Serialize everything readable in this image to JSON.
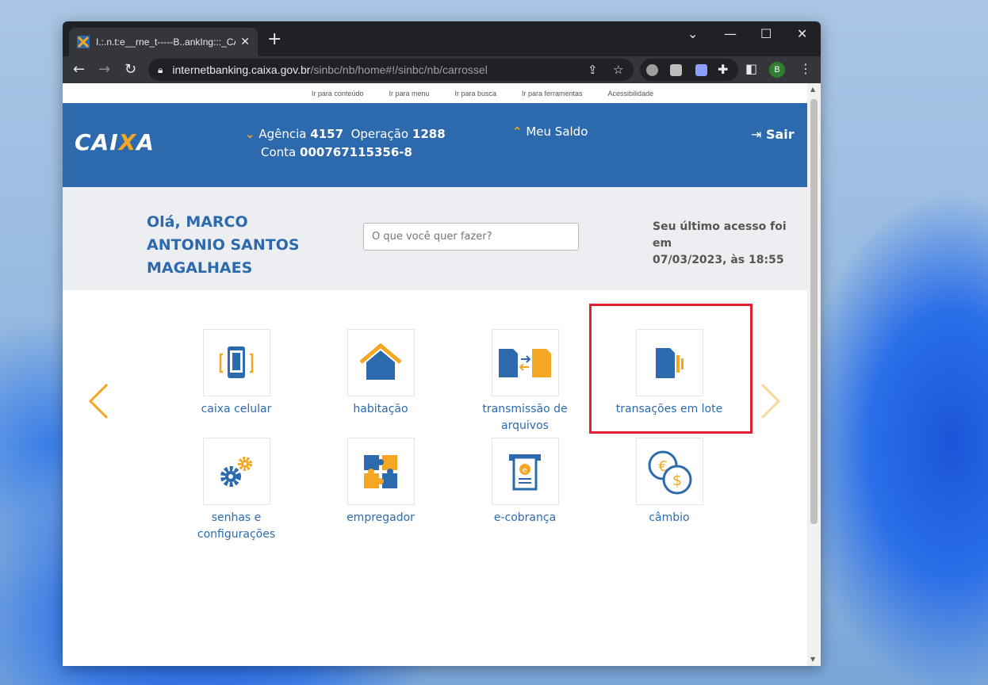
{
  "browser": {
    "tab_title": "I.:.n.t:e__rne_t-----B..ankIng:::_CA.r",
    "url_host": "internetbanking.caixa.gov.br",
    "url_path": "/sinbc/nb/home#!/sinbc/nb/carrossel",
    "profile_initial": "B"
  },
  "accessibility_bar": [
    "Ir para conteúdo",
    "Ir para menu",
    "Ir para busca",
    "Ir para ferramentas",
    "Acessibilidade"
  ],
  "header": {
    "logo": "CAIXA",
    "agency_label": "Agência",
    "agency_value": "4157",
    "operation_label": "Operação",
    "operation_value": "1288",
    "account_label": "Conta",
    "account_value": "000767115356-8",
    "balance_label": "Meu Saldo",
    "logout_label": "Sair"
  },
  "welcome": {
    "greeting": "Olá, MARCO ANTONIO SANTOS MAGALHAES",
    "search_placeholder": "O que você quer fazer?",
    "last_access_line1": "Seu último acesso foi em",
    "last_access_line2": "07/03/2023, às 18:55"
  },
  "tiles": [
    {
      "label": "caixa celular",
      "icon": "phone-icon"
    },
    {
      "label": "habitação",
      "icon": "house-icon"
    },
    {
      "label": "transmissão de arquivos",
      "icon": "file-transfer-icon"
    },
    {
      "label": "transações em lote",
      "icon": "batch-transactions-icon"
    },
    {
      "label": "senhas e configurações",
      "icon": "gears-icon"
    },
    {
      "label": "empregador",
      "icon": "puzzle-icon"
    },
    {
      "label": "e-cobrança",
      "icon": "e-billing-icon"
    },
    {
      "label": "câmbio",
      "icon": "currency-exchange-icon"
    }
  ],
  "colors": {
    "brand_blue": "#2d6aad",
    "brand_orange": "#f5a623",
    "highlight_red": "#e0202e"
  }
}
